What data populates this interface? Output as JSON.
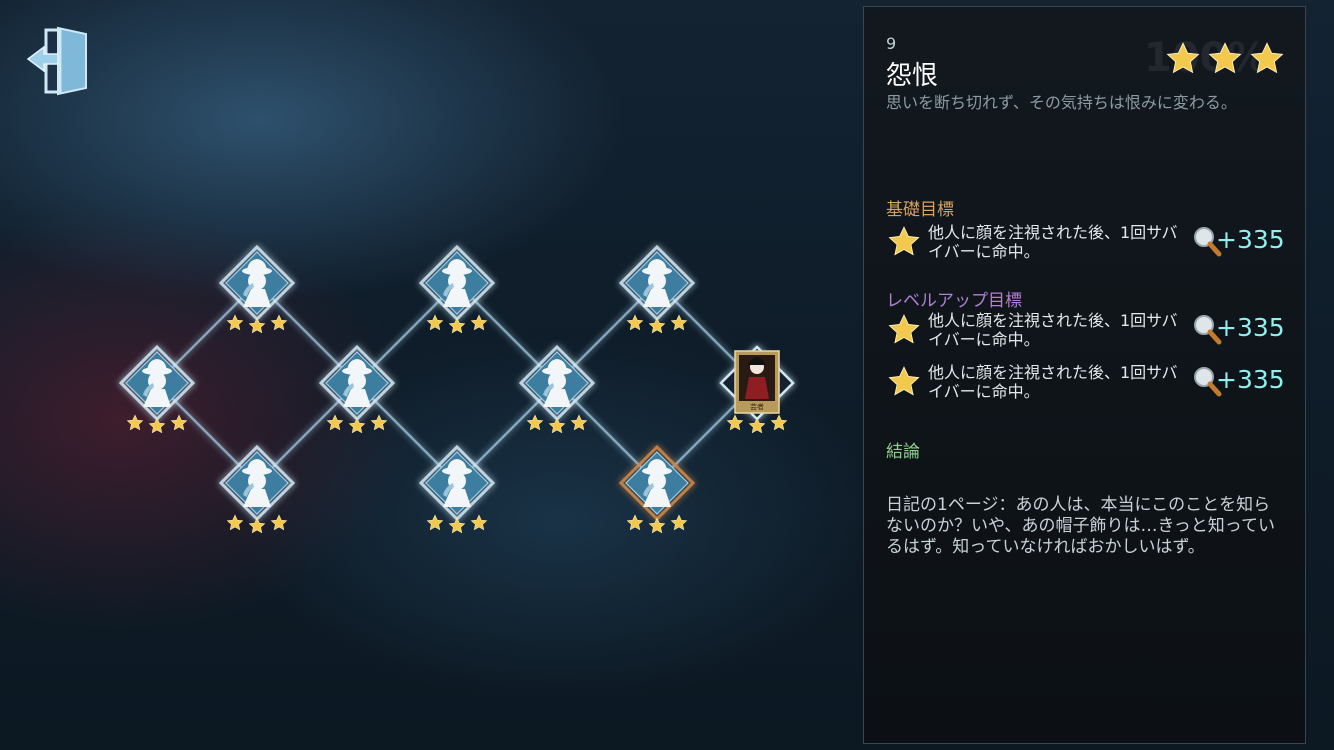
{
  "stage": {
    "number": "9",
    "title": "怨恨",
    "completion_watermark": "100%",
    "description": "思いを断ち切れず、その気持ちは恨みに変わる。",
    "rating_stars": 3
  },
  "goals": {
    "basic_label": "基礎目標",
    "basic": [
      {
        "text": "他人に顔を注視された後、1回サバイバーに命中。",
        "reward": "+335",
        "icon": "magnifier-icon"
      }
    ],
    "levelup_label": "レベルアップ目標",
    "levelup": [
      {
        "text": "他人に顔を注視された後、1回サバイバーに命中。",
        "reward": "+335",
        "icon": "magnifier-icon"
      },
      {
        "text": "他人に顔を注視された後、1回サバイバーに命中。",
        "reward": "+335",
        "icon": "magnifier-icon"
      }
    ]
  },
  "conclusion": {
    "label": "結論",
    "diary": "日記の1ページ：あの人は、本当にこのことを知らないのか？いや、あの帽子飾りは…きっと知っているはず。知っていなければおかしいはず。"
  },
  "portrait_caption": "芸者",
  "map_nodes": [
    {
      "id": 1,
      "icon": "detective-silhouette-icon",
      "stars": 3,
      "state": "cleared"
    },
    {
      "id": 2,
      "icon": "detective-silhouette-icon",
      "stars": 3,
      "state": "cleared"
    },
    {
      "id": 3,
      "icon": "detective-silhouette-icon",
      "stars": 3,
      "state": "cleared"
    },
    {
      "id": 4,
      "icon": "detective-silhouette-icon",
      "stars": 3,
      "state": "cleared"
    },
    {
      "id": 5,
      "icon": "detective-silhouette-icon",
      "stars": 3,
      "state": "cleared"
    },
    {
      "id": 6,
      "icon": "detective-silhouette-icon",
      "stars": 3,
      "state": "cleared"
    },
    {
      "id": 7,
      "icon": "detective-silhouette-icon",
      "stars": 3,
      "state": "cleared"
    },
    {
      "id": 8,
      "icon": "detective-silhouette-icon",
      "stars": 3,
      "state": "cleared"
    },
    {
      "id": 9,
      "icon": "detective-silhouette-icon",
      "stars": 3,
      "state": "selected"
    },
    {
      "id": 10,
      "icon": "geisha-portrait",
      "stars": 3,
      "state": "final"
    }
  ],
  "colors": {
    "star": "#f2c94c",
    "node_fill": "#3d7da0",
    "node_border": "#cfe8f6",
    "selected_border": "#d08a4a",
    "reward": "#8ff0ee"
  }
}
